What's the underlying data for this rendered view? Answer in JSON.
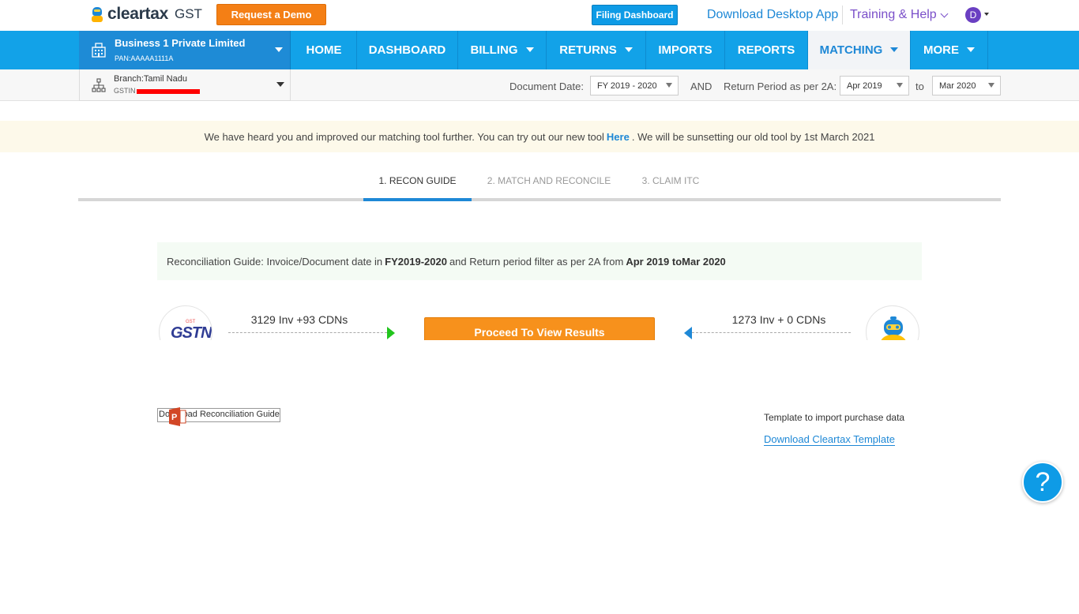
{
  "topbar": {
    "logo_text": "cleartax",
    "logo_suffix": "GST",
    "request_demo": "Request a Demo",
    "filing_dashboard": "Filing Dashboard",
    "download_desktop": "Download Desktop App",
    "training_help": "Training & Help",
    "avatar_initial": "D"
  },
  "business": {
    "name": "Business 1 Private Limited",
    "pan": "PAN:AAAAA1111A"
  },
  "nav": {
    "items": [
      {
        "label": "HOME"
      },
      {
        "label": "DASHBOARD"
      },
      {
        "label": "BILLING"
      },
      {
        "label": "RETURNS"
      },
      {
        "label": "IMPORTS"
      },
      {
        "label": "REPORTS"
      },
      {
        "label": "MATCHING"
      },
      {
        "label": "MORE"
      }
    ],
    "active": "MATCHING"
  },
  "branch": {
    "name": "Branch:Tamil Nadu",
    "gstin_label": "GSTIN"
  },
  "filters": {
    "document_date_label": "Document Date:",
    "document_date_value": "FY 2019 - 2020",
    "and_label": "AND",
    "return_period_label": "Return Period as per 2A:",
    "from_value": "Apr 2019",
    "to_label": "to",
    "to_value": "Mar 2020"
  },
  "banner": {
    "text_before": "We have heard you and improved our matching tool further. You can try out our new tool",
    "link": "Here",
    "text_after": ". We will be sunsetting our old tool by 1st March 2021"
  },
  "tabs": [
    {
      "label": "1. RECON GUIDE"
    },
    {
      "label": "2. MATCH AND RECONCILE"
    },
    {
      "label": "3. CLAIM ITC"
    }
  ],
  "guide": {
    "prefix": "Reconciliation Guide: Invoice/Document date in",
    "fy": "FY2019-2020",
    "middle": "and Return period filter as per 2A from",
    "period": "Apr 2019 toMar 2020"
  },
  "flow": {
    "gstn_count": "3129 Inv +93 CDNs",
    "proceed_label": "Proceed To View Results",
    "cleartax_count": "1273 Inv + 0 CDNs",
    "gstn_logo_text": "GSTN"
  },
  "downloads": {
    "guide_label": "Download Reconciliation Guide",
    "template_label": "Template to import purchase data",
    "template_link": "Download Cleartax Template"
  },
  "help": {
    "label": "?"
  },
  "colors": {
    "nav_blue": "#12a2e8",
    "business_blue": "#1e8bd6",
    "demo_orange": "#f47f15",
    "proceed_orange": "#f7911c",
    "link_blue": "#1e88d6",
    "training_purple": "#7a4fc9",
    "arrow_green": "#22c51d"
  }
}
